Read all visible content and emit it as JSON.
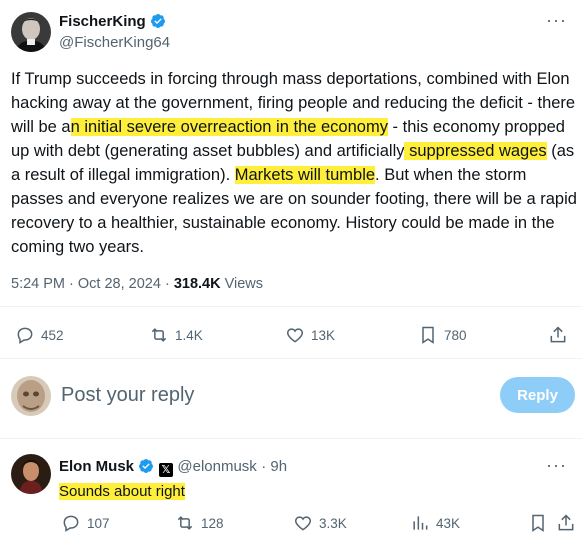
{
  "tweet": {
    "author": {
      "name": "FischerKing",
      "handle": "@FischerKing64"
    },
    "text_parts": [
      "If Trump succeeds in forcing through mass deportations, combined with Elon hacking away at the government, firing people and reducing the deficit - there will be a",
      "n initial severe overreaction in the economy",
      " - this economy propped up with debt (generating asset bubbles) and artificially",
      " suppressed wages",
      " (as a result of illegal immigration). ",
      "Markets will tumble",
      ". But when the storm passes and everyone realizes we are on sounder footing, there will be a rapid recovery to a healthier, sustainable economy. History could be made in the coming two years."
    ],
    "time": "5:24 PM · Oct 28, 2024 · ",
    "views_count": "318.4K",
    "views_label": " Views",
    "actions": {
      "replies": "452",
      "reposts": "1.4K",
      "likes": "13K",
      "bookmarks": "780"
    }
  },
  "composer": {
    "placeholder": "Post your reply",
    "button": "Reply"
  },
  "reply": {
    "author": {
      "name": "Elon Musk",
      "handle": "@elonmusk",
      "time": "· 9h"
    },
    "text": "Sounds about right",
    "actions": {
      "replies": "107",
      "reposts": "128",
      "likes": "3.3K",
      "views": "43K"
    }
  },
  "colors": {
    "highlight": "#ffef3a",
    "verified": "#1d9bf0",
    "reply_button": "#8ecdf8"
  },
  "icons": [
    "verified-badge-icon",
    "more-icon",
    "reply-icon",
    "repost-icon",
    "like-icon",
    "bookmark-icon",
    "share-icon",
    "views-icon",
    "x-affiliate-icon"
  ]
}
